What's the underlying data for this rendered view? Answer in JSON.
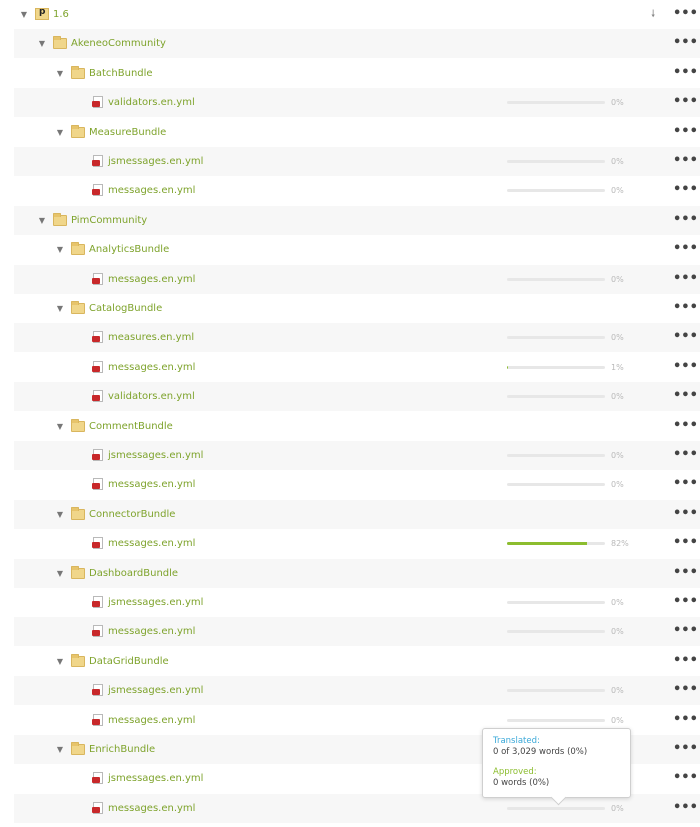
{
  "root": {
    "label": "1.6",
    "download_icon": "download-arrow-icon",
    "menu_icon": "..."
  },
  "menu_label": "•••",
  "rows": [
    {
      "type": "folder",
      "level": 1,
      "name": "AkeneoCommunity"
    },
    {
      "type": "folder",
      "level": 2,
      "name": "BatchBundle"
    },
    {
      "type": "file",
      "level": 3,
      "name": "validators.en.yml",
      "progress": 0,
      "percent": "0%"
    },
    {
      "type": "folder",
      "level": 2,
      "name": "MeasureBundle"
    },
    {
      "type": "file",
      "level": 3,
      "name": "jsmessages.en.yml",
      "progress": 0,
      "percent": "0%"
    },
    {
      "type": "file",
      "level": 3,
      "name": "messages.en.yml",
      "progress": 0,
      "percent": "0%"
    },
    {
      "type": "folder",
      "level": 1,
      "name": "PimCommunity"
    },
    {
      "type": "folder",
      "level": 2,
      "name": "AnalyticsBundle"
    },
    {
      "type": "file",
      "level": 3,
      "name": "messages.en.yml",
      "progress": 0,
      "percent": "0%"
    },
    {
      "type": "folder",
      "level": 2,
      "name": "CatalogBundle"
    },
    {
      "type": "file",
      "level": 3,
      "name": "measures.en.yml",
      "progress": 0,
      "percent": "0%"
    },
    {
      "type": "file",
      "level": 3,
      "name": "messages.en.yml",
      "progress": 1,
      "percent": "1%"
    },
    {
      "type": "file",
      "level": 3,
      "name": "validators.en.yml",
      "progress": 0,
      "percent": "0%"
    },
    {
      "type": "folder",
      "level": 2,
      "name": "CommentBundle"
    },
    {
      "type": "file",
      "level": 3,
      "name": "jsmessages.en.yml",
      "progress": 0,
      "percent": "0%"
    },
    {
      "type": "file",
      "level": 3,
      "name": "messages.en.yml",
      "progress": 0,
      "percent": "0%"
    },
    {
      "type": "folder",
      "level": 2,
      "name": "ConnectorBundle"
    },
    {
      "type": "file",
      "level": 3,
      "name": "messages.en.yml",
      "progress": 82,
      "percent": "82%"
    },
    {
      "type": "folder",
      "level": 2,
      "name": "DashboardBundle"
    },
    {
      "type": "file",
      "level": 3,
      "name": "jsmessages.en.yml",
      "progress": 0,
      "percent": "0%"
    },
    {
      "type": "file",
      "level": 3,
      "name": "messages.en.yml",
      "progress": 0,
      "percent": "0%"
    },
    {
      "type": "folder",
      "level": 2,
      "name": "DataGridBundle"
    },
    {
      "type": "file",
      "level": 3,
      "name": "jsmessages.en.yml",
      "progress": 0,
      "percent": "0%"
    },
    {
      "type": "file",
      "level": 3,
      "name": "messages.en.yml",
      "progress": 0,
      "percent": "0%"
    },
    {
      "type": "folder",
      "level": 2,
      "name": "EnrichBundle"
    },
    {
      "type": "file",
      "level": 3,
      "name": "jsmessages.en.yml",
      "progress": 0,
      "percent": "0%"
    },
    {
      "type": "file",
      "level": 3,
      "name": "messages.en.yml",
      "progress": 0,
      "percent": "0%"
    }
  ],
  "tooltip": {
    "translated_label": "Translated:",
    "translated_value": "0 of 3,029 words (0%)",
    "approved_label": "Approved:",
    "approved_value": "0 words (0%)"
  },
  "colors": {
    "link": "#7ea32c",
    "progress": "#8cbd2f",
    "translated": "#3aa8d8"
  }
}
